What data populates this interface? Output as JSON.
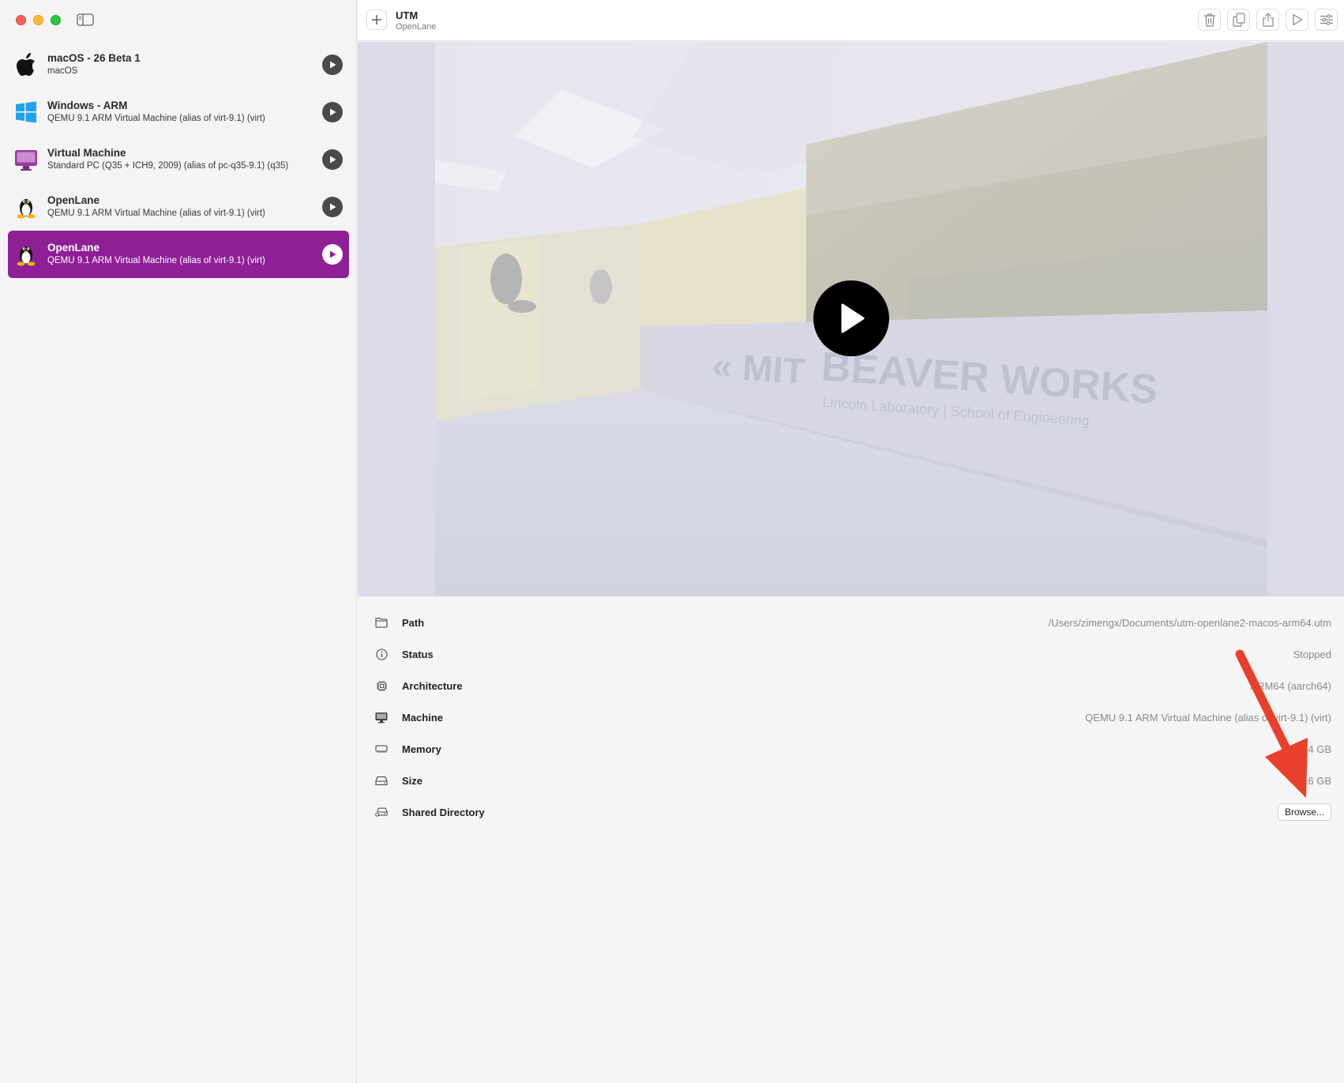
{
  "window": {
    "title": "UTM",
    "subtitle": "OpenLane"
  },
  "sidebar": {
    "items": [
      {
        "name": "macOS - 26 Beta 1",
        "subtitle": "macOS",
        "icon": "apple-icon",
        "selected": false
      },
      {
        "name": "Windows - ARM",
        "subtitle": "QEMU 9.1 ARM Virtual Machine (alias of virt-9.1) (virt)",
        "icon": "windows-icon",
        "selected": false
      },
      {
        "name": "Virtual Machine",
        "subtitle": "Standard PC (Q35 + ICH9, 2009) (alias of pc-q35-9.1) (q35)",
        "icon": "monitor-icon",
        "selected": false
      },
      {
        "name": "OpenLane",
        "subtitle": "QEMU 9.1 ARM Virtual Machine (alias of virt-9.1) (virt)",
        "icon": "linux-icon",
        "selected": false
      },
      {
        "name": "OpenLane",
        "subtitle": "QEMU 9.1 ARM Virtual Machine (alias of virt-9.1) (virt)",
        "icon": "linux-icon",
        "selected": true
      }
    ]
  },
  "preview": {
    "logo_text": "BEAVER WORKS",
    "logo_subtext": "Lincoln Laboratory | School of Engineering"
  },
  "info": {
    "path": {
      "label": "Path",
      "value": "/Users/zimengx/Documents/utm-openlane2-macos-arm64.utm"
    },
    "status": {
      "label": "Status",
      "value": "Stopped"
    },
    "architecture": {
      "label": "Architecture",
      "value": "ARM64 (aarch64)"
    },
    "machine": {
      "label": "Machine",
      "value": "QEMU 9.1 ARM Virtual Machine (alias of virt-9.1) (virt)"
    },
    "memory": {
      "label": "Memory",
      "value": "4 GB"
    },
    "size": {
      "label": "Size",
      "value": "18.6 GB"
    },
    "shared_directory": {
      "label": "Shared Directory",
      "button": "Browse..."
    }
  },
  "colors": {
    "selection": "#8e1f96",
    "annotation_arrow": "#e8402a"
  }
}
